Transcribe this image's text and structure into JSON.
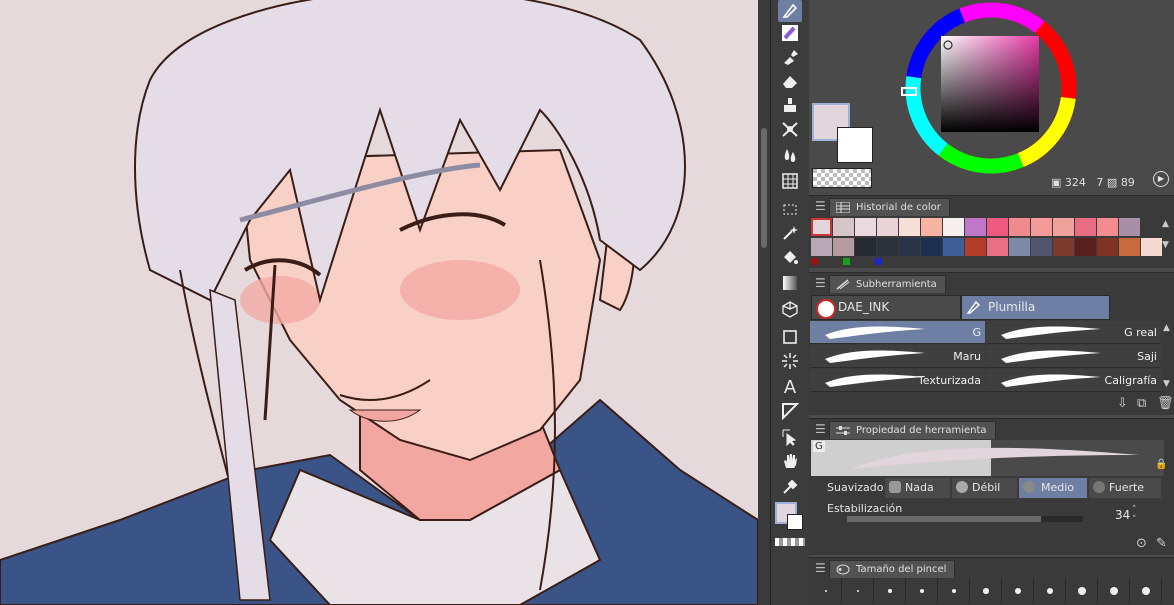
{
  "colors": {
    "main": "#e2d5dc",
    "sub": "#ffffff",
    "canvas_bg": "#e6d9dc",
    "accent": "#6f7fa3"
  },
  "color_wheel": {
    "readout_h": "324",
    "readout_s": "7",
    "readout_v": "89"
  },
  "color_history": {
    "tab": "Historial de color",
    "row1": [
      "#e2d5dc",
      "#d7c5c9",
      "#ead9de",
      "#e9d3d6",
      "#f7e0d8",
      "#f9b3a3",
      "#f7efee",
      "#c077c7",
      "#f05a80",
      "#ef8a8e",
      "#f49a99",
      "#f0a29a",
      "#e86d84",
      "#f28c8e",
      "#a88fa7"
    ],
    "row2": [
      "#b9a8b4",
      "#b59a9e",
      "#262a31",
      "#2e323d",
      "#2a3447",
      "#1e2e4f",
      "#3f5e97",
      "#b33d2a",
      "#e86f85",
      "#7d8aa8",
      "#50556e",
      "#7b3a2e",
      "#592020",
      "#7f3325",
      "#c76b3c",
      "#f3d9d0"
    ]
  },
  "subtool": {
    "tab": "Subherramienta",
    "groups": [
      "DAE_INK",
      "Plumilla"
    ],
    "brushes_left": [
      "G",
      "Maru",
      "Texturizada"
    ],
    "brushes_right": [
      "G real",
      "Saji",
      "Caligrafía"
    ]
  },
  "tool_property": {
    "tab": "Propiedad de herramienta",
    "preview_label": "G",
    "smoothing_label": "Suavizado",
    "smoothing_options": [
      "Nada",
      "Débil",
      "Medio",
      "Fuerte"
    ],
    "smoothing_selected": "Medio",
    "stabilization_label": "Estabilización",
    "stabilization_value": "34"
  },
  "brush_size": {
    "tab": "Tamaño del pincel"
  },
  "toolbar": {
    "tools": [
      "pen-icon",
      "brush-icon",
      "airbrush-icon",
      "eraser-icon",
      "blend-icon",
      "figure-icon",
      "water-icon",
      "grid-icon",
      "selection-icon",
      "magic-wand-icon",
      "fill-icon",
      "gradient-icon",
      "3d-icon",
      "rectangle-icon",
      "burst-icon",
      "text-icon",
      "ruler-icon",
      "object-icon",
      "hand-icon",
      "eyedropper-icon"
    ]
  }
}
